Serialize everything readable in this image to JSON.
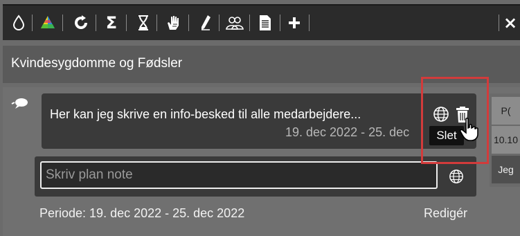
{
  "toolbar": {
    "icons": [
      "drop-icon",
      "color-palette-icon",
      "refresh-icon",
      "sigma-icon",
      "hourglass-icon",
      "hand-icon",
      "pencil-icon",
      "users-icon",
      "document-icon",
      "plus-icon"
    ],
    "close_label": "×"
  },
  "department": {
    "title": "Kvindesygdomme og Fødsler"
  },
  "message": {
    "text": "Her kan jeg skrive en info-besked til alle medarbejdere...",
    "date_range": "19. dec 2022 - 25. dec"
  },
  "tooltip": {
    "text": "Slet"
  },
  "side_panel": {
    "cells": [
      "P(",
      "10.10",
      "Jeg"
    ]
  },
  "note": {
    "placeholder": "Skriv plan note",
    "value": ""
  },
  "footer": {
    "period": "Periode: 19. dec 2022 - 25. dec 2022",
    "edit_label": "Redigér"
  },
  "colors": {
    "toolbar_bg": "#2b2b2b",
    "panel_bg": "#707070",
    "card_bg": "#3a3a3a",
    "highlight": "#d23b3b"
  }
}
